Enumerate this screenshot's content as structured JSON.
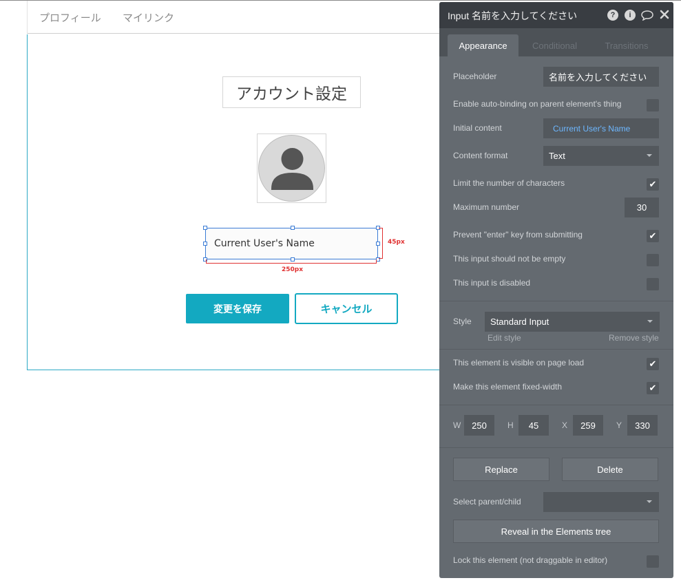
{
  "nav": {
    "links": [
      "プロフィール",
      "マイリンク"
    ]
  },
  "page": {
    "title": "アカウント設定",
    "input_value": "Current User's Name",
    "height_label": "45px",
    "width_label": "250px",
    "save_label": "変更を保存",
    "cancel_label": "キャンセル"
  },
  "colors": {
    "accent": "#13a9c1",
    "panel_bg": "#646a70",
    "panel_header": "#393d42",
    "field_bg": "#53585d",
    "link_blue": "#6db7ff",
    "dimension_red": "#e03030",
    "selection_blue": "#3a7bd5"
  },
  "panel": {
    "title": "Input 名前を入力してください",
    "icons": [
      "help-icon",
      "info-icon",
      "comment-icon",
      "close-icon"
    ],
    "tabs": [
      "Appearance",
      "Conditional",
      "Transitions"
    ],
    "placeholder_label": "Placeholder",
    "placeholder_value": "名前を入力してください",
    "autobinding_label": "Enable auto-binding on parent element's thing",
    "autobinding_checked": false,
    "initial_content_label": "Initial content",
    "initial_content_value": "Current User's Name",
    "content_format_label": "Content format",
    "content_format_value": "Text",
    "limit_chars_label": "Limit the number of characters",
    "limit_chars_checked": true,
    "max_number_label": "Maximum number",
    "max_number_value": "30",
    "prevent_enter_label": "Prevent \"enter\" key from submitting",
    "prevent_enter_checked": true,
    "not_empty_label": "This input should not be empty",
    "not_empty_checked": false,
    "disabled_label": "This input is disabled",
    "disabled_checked": false,
    "style_label": "Style",
    "style_value": "Standard Input",
    "edit_style": "Edit style",
    "remove_style": "Remove style",
    "visible_label": "This element is visible on page load",
    "visible_checked": true,
    "fixed_width_label": "Make this element fixed-width",
    "fixed_width_checked": true,
    "w_label": "W",
    "w_value": "250",
    "h_label": "H",
    "h_value": "45",
    "x_label": "X",
    "x_value": "259",
    "y_label": "Y",
    "y_value": "330",
    "replace_label": "Replace",
    "delete_label": "Delete",
    "select_parent_label": "Select parent/child",
    "reveal_label": "Reveal in the Elements tree",
    "lock_label": "Lock this element (not draggable in editor)",
    "lock_checked": false
  }
}
